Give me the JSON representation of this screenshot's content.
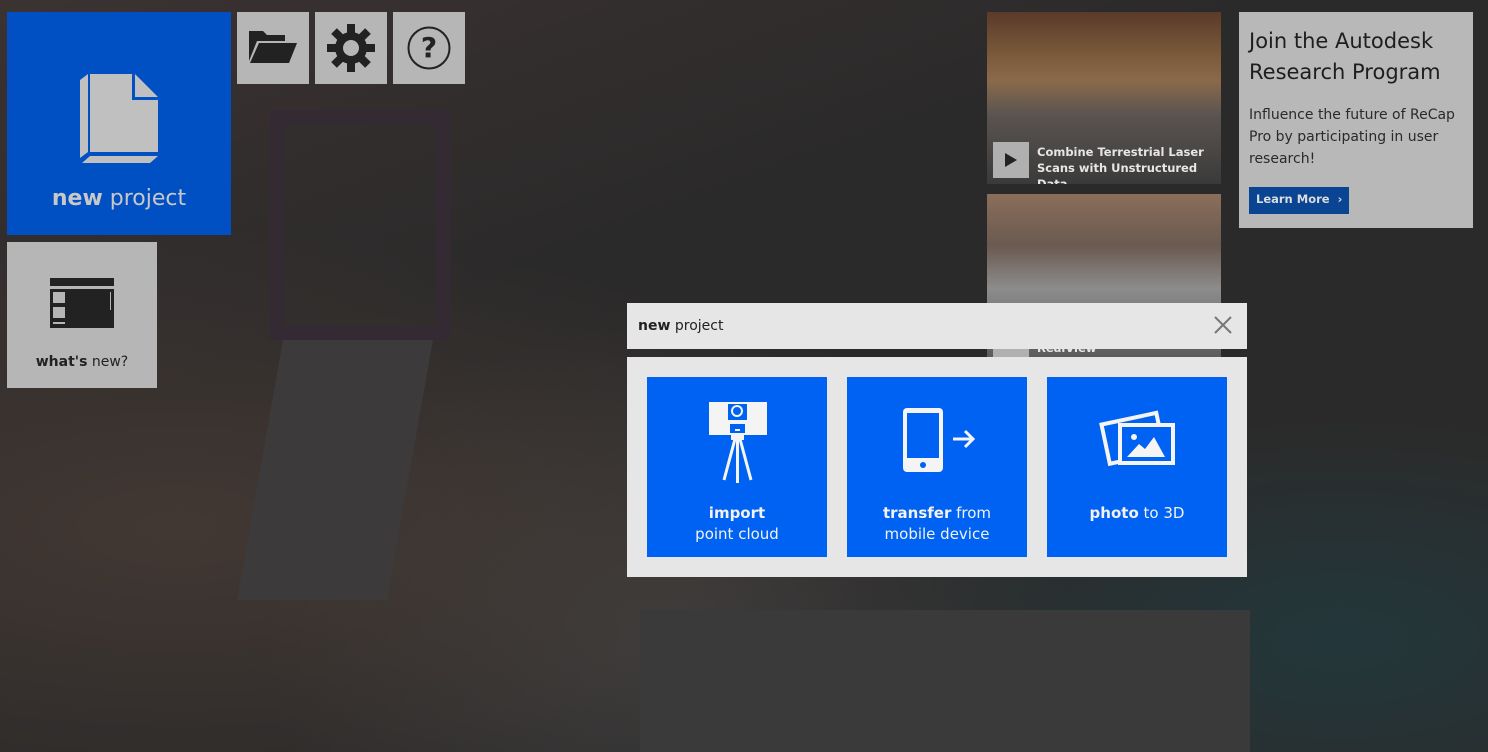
{
  "tiles": {
    "new_project": {
      "bold": "new",
      "rest": " project"
    },
    "open_icon": "folder-open-icon",
    "settings_icon": "gear-icon",
    "help_icon": "help-icon",
    "whats_new": {
      "bold": "what's",
      "rest": " new?"
    }
  },
  "videos": [
    {
      "caption": "Combine Terrestrial Laser Scans with Unstructured Data"
    },
    {
      "caption": "Interact with CAD Models in RealView"
    }
  ],
  "ad": {
    "title": "Join the Autodesk Research Program",
    "body": "Influence the future of ReCap Pro by participating in user research!",
    "button": "Learn More",
    "button_icon": "›"
  },
  "dialog": {
    "title_bold": "new",
    "title_rest": " project",
    "options": [
      {
        "bold": "import",
        "rest": "point cloud"
      },
      {
        "bold": "transfer",
        "rest_inline": " from",
        "rest": "mobile device"
      },
      {
        "bold": "photo",
        "rest_inline": " to 3D"
      }
    ]
  },
  "colors": {
    "tile_blue": "#004fc3",
    "option_blue": "#0062f2",
    "learn_more": "#0a4593"
  }
}
